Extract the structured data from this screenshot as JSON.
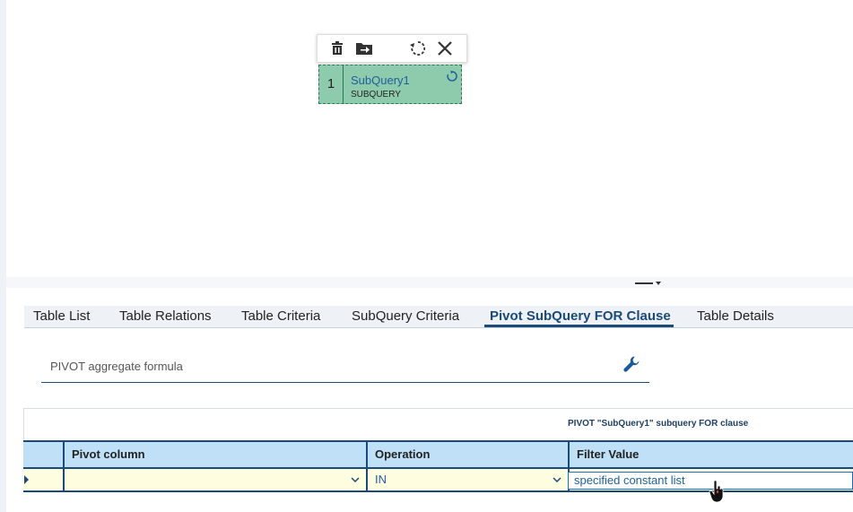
{
  "toolbar": {
    "icons": [
      "trash-icon",
      "move-out-icon",
      "refresh-icon",
      "close-icon"
    ]
  },
  "node": {
    "index": "1",
    "name": "SubQuery1",
    "kind": "SUBQUERY"
  },
  "tabs": [
    {
      "label": "Table List"
    },
    {
      "label": "Table Relations"
    },
    {
      "label": "Table Criteria"
    },
    {
      "label": "SubQuery Criteria"
    },
    {
      "label": "Pivot SubQuery FOR Clause",
      "active": true
    },
    {
      "label": "Table Details"
    }
  ],
  "formula": {
    "placeholder": "PIVOT aggregate formula"
  },
  "grid": {
    "caption": "PIVOT \"SubQuery1\" subquery FOR clause",
    "columns": [
      "Pivot column",
      "Operation",
      "Filter Value"
    ],
    "row": {
      "pivot_column": "",
      "operation": "IN",
      "filter_value_word1": "specified",
      "filter_value_word2": "constant list"
    }
  },
  "colors": {
    "accent": "#1a4a7a",
    "node_fill": "#8dcbac",
    "header_fill": "#bfe0f7",
    "row_fill": "#fffde0"
  }
}
